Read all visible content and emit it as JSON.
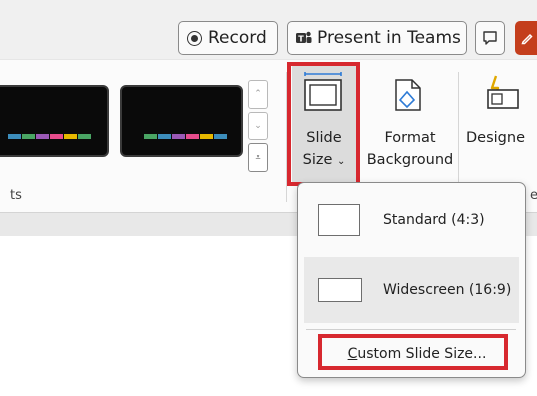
{
  "titlebar": {
    "record_label": "Record",
    "present_label": "Present in Teams",
    "comment_icon": "comment-icon",
    "share_icon": "pen-icon"
  },
  "ribbon": {
    "group_label_left": "ts",
    "slide_size": {
      "line1": "Slide",
      "line2": "Size",
      "chevron": "⌄"
    },
    "format_background": {
      "line1": "Format",
      "line2": "Background"
    },
    "designer": {
      "line1": "Designe"
    },
    "group_label_right": "e",
    "theme_stripe_colors": [
      "#3c8dbb",
      "#4aa564",
      "#9b59b6",
      "#e74c8c",
      "#f1c40f"
    ]
  },
  "slide_size_menu": {
    "items": [
      {
        "label": "Standard (4:3)"
      },
      {
        "label": "Widescreen (16:9)"
      }
    ],
    "custom": {
      "accel": "C",
      "rest": "ustom Slide Size..."
    }
  },
  "colors": {
    "highlight": "#d7282f",
    "accent": "#c43e1c"
  }
}
